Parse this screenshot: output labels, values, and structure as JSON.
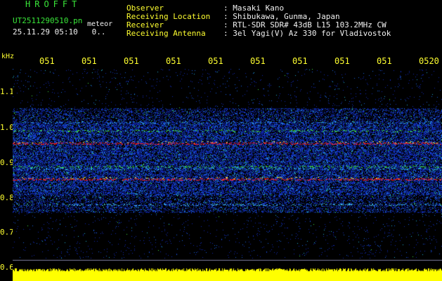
{
  "header": {
    "logo": "HROFFT",
    "filename": "UT2511290510.pn",
    "tag": "meteor",
    "datetime": "25.11.29 05:10",
    "datetime_suffix": "0..",
    "meta_labels": "Observer\nReceiving Location\nReceiver\nReceiving Antenna",
    "meta_values": ": Masaki Kano\n: Shibukawa, Gunma, Japan\n: RTL-SDR SDR# 43dB L15 103.2MHz CW\n: 3el Yagi(V) Az 330 for Vladivostok"
  },
  "axis": {
    "unit": "kHz",
    "y_ticks": [
      "1.1",
      "1.0",
      "0.9",
      "0.8",
      "0.7",
      "0.6"
    ],
    "x_ticks": [
      "051",
      "051",
      "051",
      "051",
      "051",
      "051",
      "051",
      "051",
      "051",
      "0520"
    ]
  },
  "colors": {
    "background": "#000000",
    "axis_text": "#ffff30",
    "logo": "#39e639",
    "header_text": "#f2f2f2",
    "noise_band": "#1030c0",
    "carrier_red": "#ff2020",
    "carrier_green": "#40e040",
    "bottom_bar": "#ffff00"
  }
}
